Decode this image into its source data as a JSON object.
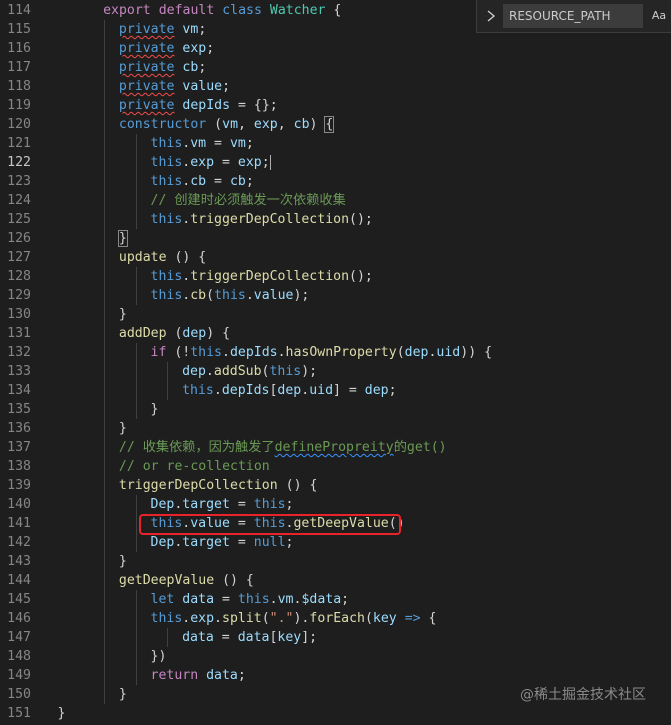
{
  "resource_panel": {
    "input_text": "RESOURCE_PATH",
    "case_toggle": "Aa"
  },
  "watermark": "@稀土掘金技术社区",
  "line_numbers": [
    "114",
    "115",
    "116",
    "117",
    "118",
    "119",
    "120",
    "121",
    "122",
    "123",
    "124",
    "125",
    "126",
    "127",
    "128",
    "129",
    "130",
    "131",
    "132",
    "133",
    "134",
    "135",
    "136",
    "137",
    "138",
    "139",
    "140",
    "141",
    "142",
    "143",
    "144",
    "145",
    "146",
    "147",
    "148",
    "149",
    "150",
    "151"
  ],
  "current_line_index": 8,
  "highlighted_line_index": 27,
  "lines": [
    {
      "indent": 2,
      "tokens": [
        [
          "export",
          "kw2"
        ],
        [
          " ",
          "p"
        ],
        [
          "default",
          "kw2"
        ],
        [
          " ",
          "p"
        ],
        [
          "class",
          "kw"
        ],
        [
          " ",
          "p"
        ],
        [
          "Watcher",
          "cls"
        ],
        [
          " {",
          "p"
        ]
      ]
    },
    {
      "indent": 3,
      "tokens": [
        [
          "private",
          "kw warn"
        ],
        [
          " ",
          "p"
        ],
        [
          "vm",
          "var"
        ],
        [
          ";",
          "p"
        ]
      ]
    },
    {
      "indent": 3,
      "tokens": [
        [
          "private",
          "kw warn"
        ],
        [
          " ",
          "p"
        ],
        [
          "exp",
          "var"
        ],
        [
          ";",
          "p"
        ]
      ]
    },
    {
      "indent": 3,
      "tokens": [
        [
          "private",
          "kw warn"
        ],
        [
          " ",
          "p"
        ],
        [
          "cb",
          "var"
        ],
        [
          ";",
          "p"
        ]
      ]
    },
    {
      "indent": 3,
      "tokens": [
        [
          "private",
          "kw warn"
        ],
        [
          " ",
          "p"
        ],
        [
          "value",
          "var"
        ],
        [
          ";",
          "p"
        ]
      ]
    },
    {
      "indent": 3,
      "tokens": [
        [
          "private",
          "kw warn"
        ],
        [
          " ",
          "p"
        ],
        [
          "depIds",
          "var"
        ],
        [
          " = {};",
          "p"
        ]
      ]
    },
    {
      "indent": 3,
      "tokens": [
        [
          "constructor",
          "kw"
        ],
        [
          " (",
          "p"
        ],
        [
          "vm",
          "var"
        ],
        [
          ", ",
          "p"
        ],
        [
          "exp",
          "var"
        ],
        [
          ", ",
          "p"
        ],
        [
          "cb",
          "var"
        ],
        [
          ") ",
          "p"
        ],
        [
          "{",
          "p bracket"
        ]
      ]
    },
    {
      "indent": 5,
      "tokens": [
        [
          "this",
          "kw"
        ],
        [
          ".",
          "p"
        ],
        [
          "vm",
          "var"
        ],
        [
          " = ",
          "p"
        ],
        [
          "vm",
          "var"
        ],
        [
          ";",
          "p"
        ]
      ]
    },
    {
      "indent": 5,
      "tokens": [
        [
          "this",
          "kw"
        ],
        [
          ".",
          "p"
        ],
        [
          "exp",
          "var"
        ],
        [
          " = ",
          "p"
        ],
        [
          "exp",
          "var"
        ],
        [
          ";",
          "p cursor"
        ]
      ]
    },
    {
      "indent": 5,
      "tokens": [
        [
          "this",
          "kw"
        ],
        [
          ".",
          "p"
        ],
        [
          "cb",
          "var"
        ],
        [
          " = ",
          "p"
        ],
        [
          "cb",
          "var"
        ],
        [
          ";",
          "p"
        ]
      ]
    },
    {
      "indent": 5,
      "tokens": [
        [
          "// 创建时必须触发一次依赖收集",
          "cm"
        ]
      ]
    },
    {
      "indent": 5,
      "tokens": [
        [
          "this",
          "kw"
        ],
        [
          ".",
          "p"
        ],
        [
          "triggerDepCollection",
          "fn"
        ],
        [
          "();",
          "p"
        ]
      ]
    },
    {
      "indent": 3,
      "tokens": [
        [
          "}",
          "p bracket"
        ]
      ]
    },
    {
      "indent": 3,
      "tokens": [
        [
          "update",
          "fn"
        ],
        [
          " () {",
          "p"
        ]
      ]
    },
    {
      "indent": 5,
      "tokens": [
        [
          "this",
          "kw"
        ],
        [
          ".",
          "p"
        ],
        [
          "triggerDepCollection",
          "fn"
        ],
        [
          "();",
          "p"
        ]
      ]
    },
    {
      "indent": 5,
      "tokens": [
        [
          "this",
          "kw"
        ],
        [
          ".",
          "p"
        ],
        [
          "cb",
          "fn"
        ],
        [
          "(",
          "p"
        ],
        [
          "this",
          "kw"
        ],
        [
          ".",
          "p"
        ],
        [
          "value",
          "var"
        ],
        [
          ");",
          "p"
        ]
      ]
    },
    {
      "indent": 3,
      "tokens": [
        [
          "}",
          "p"
        ]
      ]
    },
    {
      "indent": 3,
      "tokens": [
        [
          "addDep",
          "fn"
        ],
        [
          " (",
          "p"
        ],
        [
          "dep",
          "var"
        ],
        [
          ") {",
          "p"
        ]
      ]
    },
    {
      "indent": 5,
      "tokens": [
        [
          "if",
          "kw2"
        ],
        [
          " (!",
          "p"
        ],
        [
          "this",
          "kw"
        ],
        [
          ".",
          "p"
        ],
        [
          "depIds",
          "var"
        ],
        [
          ".",
          "p"
        ],
        [
          "hasOwnProperty",
          "fn"
        ],
        [
          "(",
          "p"
        ],
        [
          "dep",
          "var"
        ],
        [
          ".",
          "p"
        ],
        [
          "uid",
          "var"
        ],
        [
          ")) {",
          "p"
        ]
      ]
    },
    {
      "indent": 7,
      "tokens": [
        [
          "dep",
          "var"
        ],
        [
          ".",
          "p"
        ],
        [
          "addSub",
          "fn"
        ],
        [
          "(",
          "p"
        ],
        [
          "this",
          "kw"
        ],
        [
          ");",
          "p"
        ]
      ]
    },
    {
      "indent": 7,
      "tokens": [
        [
          "this",
          "kw"
        ],
        [
          ".",
          "p"
        ],
        [
          "depIds",
          "var"
        ],
        [
          "[",
          "p"
        ],
        [
          "dep",
          "var"
        ],
        [
          ".",
          "p"
        ],
        [
          "uid",
          "var"
        ],
        [
          "] = ",
          "p"
        ],
        [
          "dep",
          "var"
        ],
        [
          ";",
          "p"
        ]
      ]
    },
    {
      "indent": 5,
      "tokens": [
        [
          "}",
          "p"
        ]
      ]
    },
    {
      "indent": 3,
      "tokens": [
        [
          "}",
          "p"
        ]
      ]
    },
    {
      "indent": 3,
      "tokens": [
        [
          "// 收集依赖，因为触发了",
          "cm"
        ],
        [
          "definePropreity",
          "cm info"
        ],
        [
          "的get()",
          "cm"
        ]
      ]
    },
    {
      "indent": 3,
      "tokens": [
        [
          "// or re-collection",
          "cm"
        ]
      ]
    },
    {
      "indent": 3,
      "tokens": [
        [
          "triggerDepCollection",
          "fn"
        ],
        [
          " () {",
          "p"
        ]
      ]
    },
    {
      "indent": 5,
      "tokens": [
        [
          "Dep",
          "var"
        ],
        [
          ".",
          "p"
        ],
        [
          "target",
          "var"
        ],
        [
          " = ",
          "p"
        ],
        [
          "this",
          "kw"
        ],
        [
          ";",
          "p"
        ]
      ]
    },
    {
      "indent": 5,
      "tokens": [
        [
          "this",
          "kw"
        ],
        [
          ".",
          "p"
        ],
        [
          "value",
          "var"
        ],
        [
          " = ",
          "p"
        ],
        [
          "this",
          "kw"
        ],
        [
          ".",
          "p"
        ],
        [
          "getDeepValue",
          "fn"
        ],
        [
          "()",
          "p"
        ]
      ]
    },
    {
      "indent": 5,
      "tokens": [
        [
          "Dep",
          "var"
        ],
        [
          ".",
          "p"
        ],
        [
          "target",
          "var"
        ],
        [
          " = ",
          "p"
        ],
        [
          "null",
          "kw"
        ],
        [
          ";",
          "p"
        ]
      ]
    },
    {
      "indent": 3,
      "tokens": [
        [
          "}",
          "p"
        ]
      ]
    },
    {
      "indent": 3,
      "tokens": [
        [
          "getDeepValue",
          "fn"
        ],
        [
          " () {",
          "p"
        ]
      ]
    },
    {
      "indent": 5,
      "tokens": [
        [
          "let",
          "kw"
        ],
        [
          " ",
          "p"
        ],
        [
          "data",
          "var"
        ],
        [
          " = ",
          "p"
        ],
        [
          "this",
          "kw"
        ],
        [
          ".",
          "p"
        ],
        [
          "vm",
          "var"
        ],
        [
          ".",
          "p"
        ],
        [
          "$data",
          "var"
        ],
        [
          ";",
          "p"
        ]
      ]
    },
    {
      "indent": 5,
      "tokens": [
        [
          "this",
          "kw"
        ],
        [
          ".",
          "p"
        ],
        [
          "exp",
          "var"
        ],
        [
          ".",
          "p"
        ],
        [
          "split",
          "fn"
        ],
        [
          "(",
          "p"
        ],
        [
          "\".\"",
          "str"
        ],
        [
          ").",
          "p"
        ],
        [
          "forEach",
          "fn"
        ],
        [
          "(",
          "p"
        ],
        [
          "key",
          "var"
        ],
        [
          " ",
          "p"
        ],
        [
          "=>",
          "kw"
        ],
        [
          " {",
          "p"
        ]
      ]
    },
    {
      "indent": 7,
      "tokens": [
        [
          "data",
          "var"
        ],
        [
          " = ",
          "p"
        ],
        [
          "data",
          "var"
        ],
        [
          "[",
          "p"
        ],
        [
          "key",
          "var"
        ],
        [
          "];",
          "p"
        ]
      ]
    },
    {
      "indent": 5,
      "tokens": [
        [
          "})",
          "p"
        ]
      ]
    },
    {
      "indent": 5,
      "tokens": [
        [
          "return",
          "kw2"
        ],
        [
          " ",
          "p"
        ],
        [
          "data",
          "var"
        ],
        [
          ";",
          "p"
        ]
      ]
    },
    {
      "indent": 3,
      "tokens": [
        [
          "}",
          "p"
        ]
      ]
    },
    {
      "indent": 0,
      "tokens": [
        [
          "}",
          "p"
        ]
      ]
    }
  ]
}
